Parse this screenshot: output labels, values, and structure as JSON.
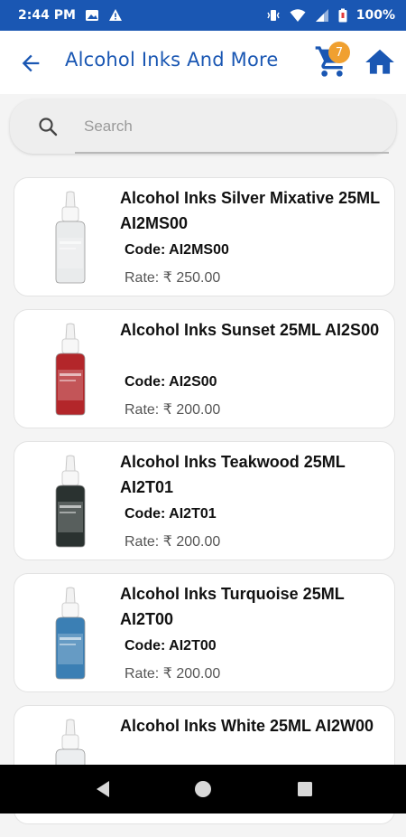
{
  "status_bar": {
    "time": "2:44 PM",
    "battery": "100%",
    "icons": [
      "image-icon",
      "warning-icon",
      "vibrate-icon",
      "wifi-icon",
      "signal-icon",
      "battery-icon"
    ]
  },
  "app_bar": {
    "title": "Alcohol Inks And More",
    "cart_count": "7"
  },
  "search": {
    "placeholder": "Search"
  },
  "products": [
    {
      "name": "Alcohol Inks Silver Mixative 25ML AI2MS00",
      "code": "Code: AI2MS00",
      "rate": "Rate: ₹ 250.00",
      "bottle_color": "#e9ebec"
    },
    {
      "name": "Alcohol Inks Sunset 25ML AI2S00",
      "code": "Code: AI2S00",
      "rate": "Rate: ₹ 200.00",
      "bottle_color": "#b3262a"
    },
    {
      "name": "Alcohol Inks Teakwood 25ML AI2T01",
      "code": "Code: AI2T01",
      "rate": "Rate: ₹ 200.00",
      "bottle_color": "#2a3230"
    },
    {
      "name": "Alcohol Inks Turquoise 25ML AI2T00",
      "code": "Code: AI2T00",
      "rate": "Rate: ₹ 200.00",
      "bottle_color": "#3b7fb4"
    },
    {
      "name": "Alcohol Inks White 25ML AI2W00",
      "code": "",
      "rate": "",
      "bottle_color": "#eceef0"
    }
  ],
  "colors": {
    "primary": "#1a57b3",
    "badge": "#f0a030",
    "background": "#f4f4f4"
  }
}
